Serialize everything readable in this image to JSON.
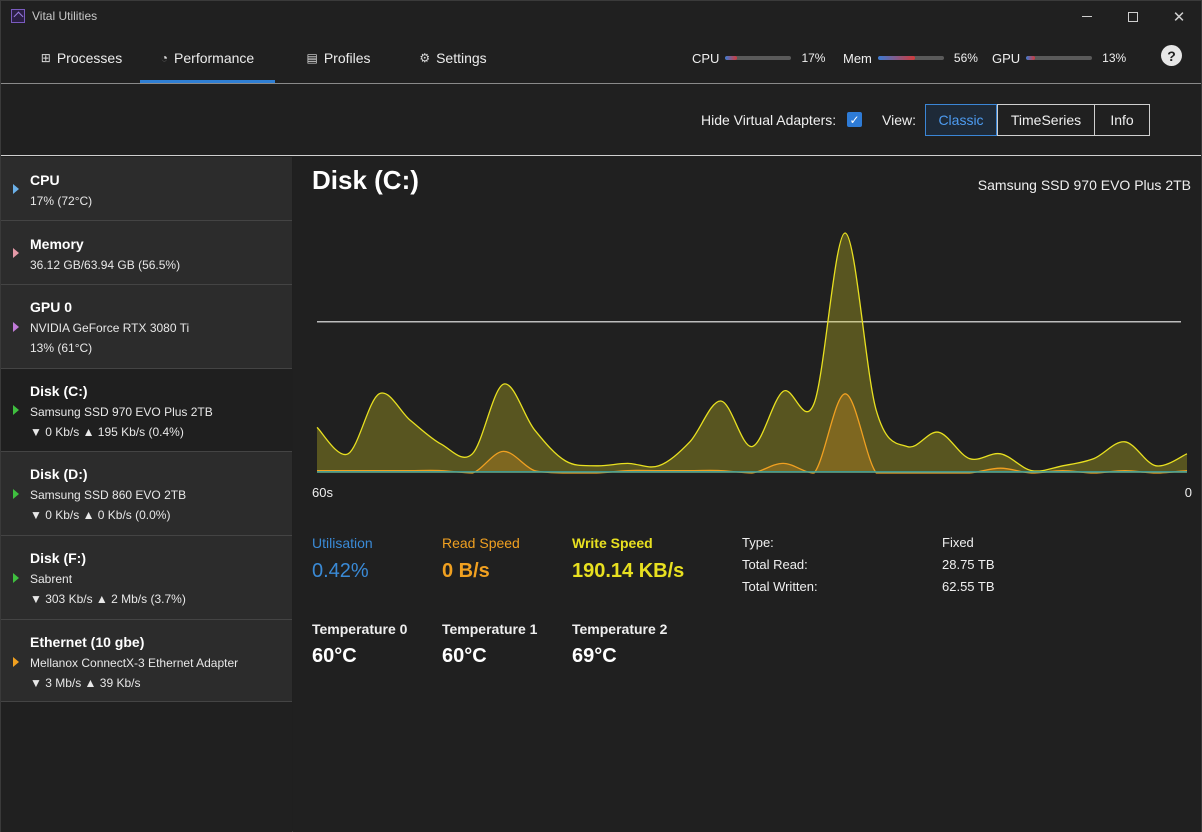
{
  "window": {
    "title": "Vital Utilities"
  },
  "nav": {
    "tabs": [
      {
        "label": "Processes",
        "icon": "grid-icon"
      },
      {
        "label": "Performance",
        "icon": "gauge-icon"
      },
      {
        "label": "Profiles",
        "icon": "document-icon"
      },
      {
        "label": "Settings",
        "icon": "gear-icon"
      }
    ],
    "active_tab": "Performance",
    "meters": {
      "cpu": {
        "label": "CPU",
        "value": "17%",
        "fraction": 0.17
      },
      "mem": {
        "label": "Mem",
        "value": "56%",
        "fraction": 0.56
      },
      "gpu": {
        "label": "GPU",
        "value": "13%",
        "fraction": 0.13
      }
    },
    "help_label": "?"
  },
  "toolbar": {
    "hide_virtual_label": "Hide Virtual Adapters:",
    "hide_virtual_checked": true,
    "view_label": "View:",
    "view_options": [
      "Classic",
      "TimeSeries",
      "Info"
    ],
    "view_selected": "Classic"
  },
  "sidebar": {
    "items": [
      {
        "title": "CPU",
        "lines": [
          "17% (72°C)"
        ],
        "arrow_color": "#6bb0e8"
      },
      {
        "title": "Memory",
        "lines": [
          "36.12 GB/63.94 GB (56.5%)"
        ],
        "arrow_color": "#e59aa8"
      },
      {
        "title": "GPU 0",
        "lines": [
          "NVIDIA GeForce RTX 3080 Ti",
          "13% (61°C)"
        ],
        "arrow_color": "#c07ad8"
      },
      {
        "title": "Disk (C:)",
        "lines": [
          "Samsung SSD 970 EVO Plus 2TB",
          "▼ 0 Kb/s ▲ 195 Kb/s (0.4%)"
        ],
        "arrow_color": "#3fbf3f"
      },
      {
        "title": "Disk (D:)",
        "lines": [
          "Samsung SSD 860 EVO 2TB",
          "▼ 0 Kb/s ▲ 0 Kb/s (0.0%)"
        ],
        "arrow_color": "#3fbf3f"
      },
      {
        "title": "Disk (F:)",
        "lines": [
          "Sabrent",
          "▼ 303 Kb/s ▲ 2 Mb/s (3.7%)"
        ],
        "arrow_color": "#3fbf3f"
      },
      {
        "title": "Ethernet (10 gbe)",
        "lines": [
          "Mellanox ConnectX-3 Ethernet Adapter",
          "▼ 3 Mb/s ▲ 39 Kb/s"
        ],
        "arrow_color": "#f0a020"
      }
    ],
    "active_index": 3
  },
  "main": {
    "title": "Disk (C:)",
    "model": "Samsung SSD 970 EVO Plus 2TB",
    "axis_left": "60s",
    "axis_right": "0",
    "stats": [
      {
        "label": "Utilisation",
        "value": "0.42%",
        "color": "#3a8ad6"
      },
      {
        "label": "Read Speed",
        "value": "0 B/s",
        "color": "#f0a020"
      },
      {
        "label": "Write Speed",
        "value": "190.14 KB/s",
        "color": "#e8e020"
      }
    ],
    "info": [
      {
        "key": "Type:",
        "value": "Fixed"
      },
      {
        "key": "Total Read:",
        "value": "28.75 TB"
      },
      {
        "key": "Total Written:",
        "value": "62.55 TB"
      }
    ],
    "temperatures": [
      {
        "label": "Temperature 0",
        "value": "60°C"
      },
      {
        "label": "Temperature 1",
        "value": "60°C"
      },
      {
        "label": "Temperature 2",
        "value": "69°C"
      }
    ]
  },
  "chart_data": {
    "type": "area",
    "x_range": [
      60,
      0
    ],
    "threshold_line": 0.63,
    "series": [
      {
        "color": "#e8e020",
        "values": [
          0.19,
          0.08,
          0.33,
          0.22,
          0.12,
          0.08,
          0.37,
          0.18,
          0.05,
          0.03,
          0.04,
          0.03,
          0.13,
          0.3,
          0.11,
          0.34,
          0.29,
          1.0,
          0.26,
          0.11,
          0.17,
          0.06,
          0.08,
          0.01,
          0.03,
          0.06,
          0.13,
          0.03,
          0.08
        ]
      },
      {
        "color": "#f0a020",
        "values": [
          0.01,
          0.01,
          0.01,
          0.01,
          0.01,
          0.0,
          0.09,
          0.01,
          0.0,
          0.0,
          0.01,
          0.01,
          0.01,
          0.01,
          0.0,
          0.04,
          0.0,
          0.33,
          0.0,
          0.0,
          0.0,
          0.0,
          0.02,
          0.0,
          0.01,
          0.0,
          0.01,
          0.0,
          0.01
        ]
      },
      {
        "color": "#3aa0a0",
        "values": [
          0.005,
          0.005,
          0.005,
          0.005,
          0.005,
          0.005,
          0.005,
          0.005,
          0.005,
          0.005,
          0.005,
          0.005,
          0.005,
          0.005,
          0.005,
          0.005,
          0.005,
          0.005,
          0.005,
          0.005,
          0.005,
          0.005,
          0.005,
          0.005,
          0.005,
          0.005,
          0.005,
          0.005,
          0.005
        ]
      }
    ]
  }
}
